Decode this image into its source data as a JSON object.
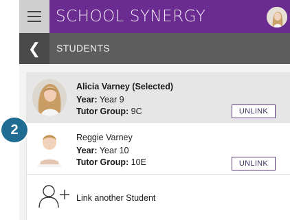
{
  "header": {
    "app_title": "SCHOOL SYNERGY",
    "page_title": "STUDENTS",
    "back_glyph": "❮"
  },
  "step_badge": "2",
  "students": [
    {
      "name": "Alicia Varney (Selected)",
      "selected": true,
      "year_label": "Year:",
      "year_value": "Year 9",
      "tutor_label": "Tutor Group:",
      "tutor_value": "9C",
      "unlink_label": "UNLINK"
    },
    {
      "name": "Reggie Varney",
      "selected": false,
      "year_label": "Year:",
      "year_value": "Year 10",
      "tutor_label": "Tutor Group:",
      "tutor_value": "10E",
      "unlink_label": "UNLINK"
    }
  ],
  "link_another_label": "Link another Student",
  "colors": {
    "brand": "#6b2c91",
    "subbar": "#5d5d5d",
    "badge": "#1f6d93"
  }
}
